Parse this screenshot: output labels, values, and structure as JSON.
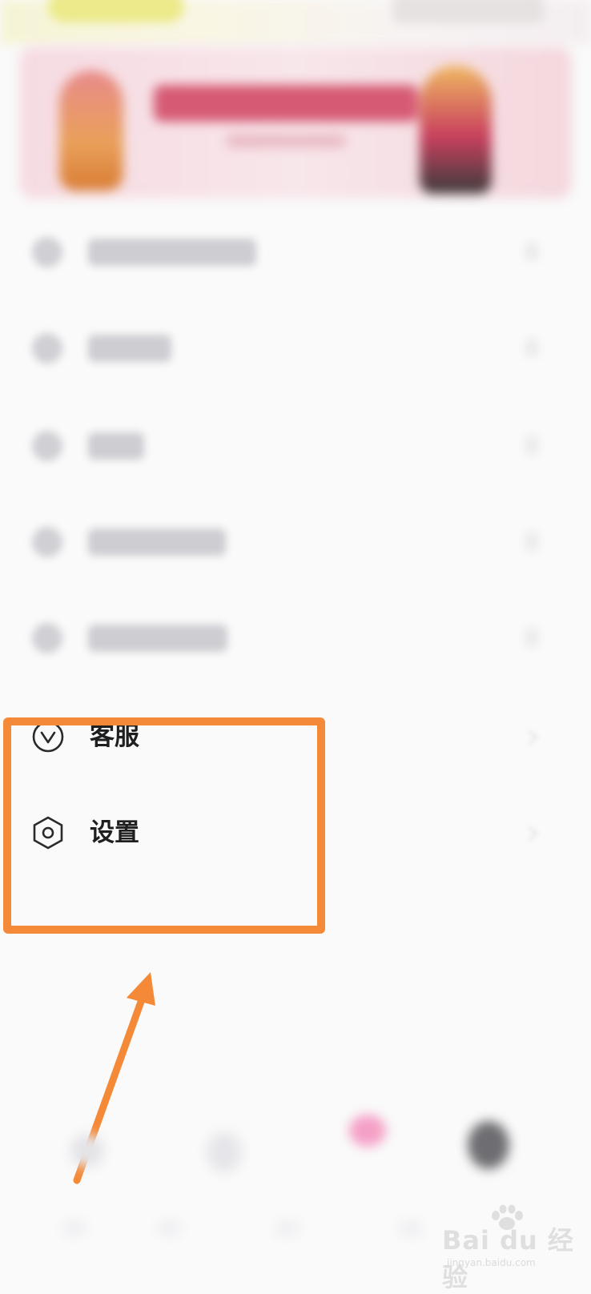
{
  "menu": {
    "items": [
      {
        "label": "客服",
        "icon": "customer-service-icon"
      },
      {
        "label": "设置",
        "icon": "settings-hexagon-icon"
      }
    ]
  },
  "annotation": {
    "color": "#f48a38",
    "highlight_target": "设置"
  },
  "watermark": {
    "text": "Bai du 经验",
    "url": "jingyan.baidu.com"
  },
  "colors": {
    "text_primary": "#1f1f1f",
    "background": "#fafafa",
    "banner_pink": "#f6dbe2"
  }
}
